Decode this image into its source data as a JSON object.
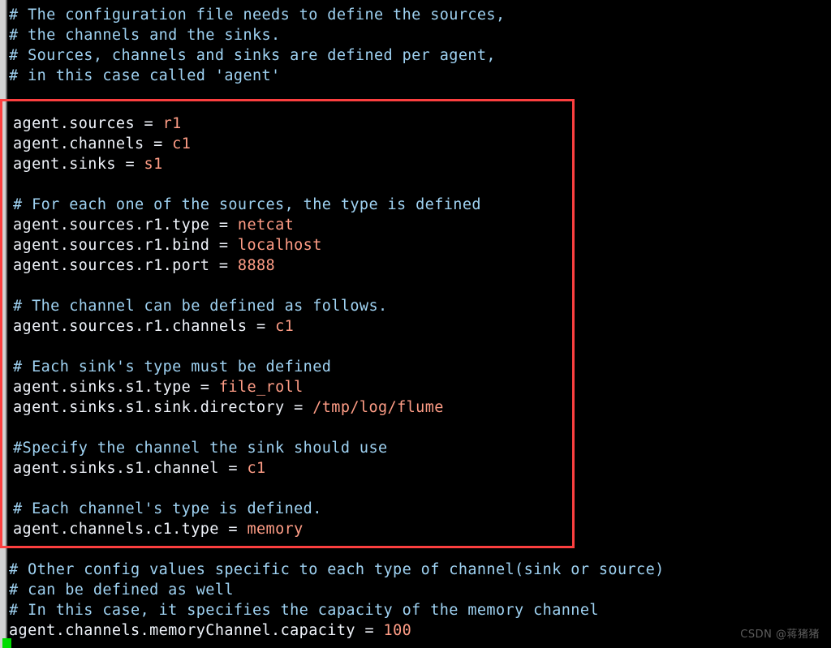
{
  "terminal": {
    "background_color": "#000000",
    "comment_color": "#9fd2f2",
    "key_color": "#f0f4fb",
    "value_color": "#ff9d86",
    "highlight_border_color": "#fc3f3f",
    "cursor_color": "#00dd00",
    "scrollbar_color": "#d2d2d2"
  },
  "header_comments": [
    "# The configuration file needs to define the sources,",
    "# the channels and the sinks.",
    "# Sources, channels and sinks are defined per agent,",
    "# in this case called 'agent'"
  ],
  "config_block": [
    {
      "type": "setting",
      "key": "agent.sources",
      "op": " = ",
      "value": "r1"
    },
    {
      "type": "setting",
      "key": "agent.channels",
      "op": " = ",
      "value": "c1"
    },
    {
      "type": "setting",
      "key": "agent.sinks",
      "op": " = ",
      "value": "s1"
    },
    {
      "type": "blank",
      "text": ""
    },
    {
      "type": "comment",
      "text": "# For each one of the sources, the type is defined"
    },
    {
      "type": "setting",
      "key": "agent.sources.r1.type",
      "op": " = ",
      "value": "netcat"
    },
    {
      "type": "setting",
      "key": "agent.sources.r1.bind",
      "op": " = ",
      "value": "localhost"
    },
    {
      "type": "setting",
      "key": "agent.sources.r1.port",
      "op": " = ",
      "value": "8888"
    },
    {
      "type": "blank",
      "text": ""
    },
    {
      "type": "comment",
      "text": "# The channel can be defined as follows."
    },
    {
      "type": "setting",
      "key": "agent.sources.r1.channels",
      "op": " = ",
      "value": "c1"
    },
    {
      "type": "blank",
      "text": ""
    },
    {
      "type": "comment",
      "text": "# Each sink's type must be defined"
    },
    {
      "type": "setting",
      "key": "agent.sinks.s1.type",
      "op": " = ",
      "value": "file_roll"
    },
    {
      "type": "setting",
      "key": "agent.sinks.s1.sink.directory",
      "op": " = ",
      "value": "/tmp/log/flume"
    },
    {
      "type": "blank",
      "text": ""
    },
    {
      "type": "comment",
      "text": "#Specify the channel the sink should use"
    },
    {
      "type": "setting",
      "key": "agent.sinks.s1.channel",
      "op": " = ",
      "value": "c1"
    },
    {
      "type": "blank",
      "text": ""
    },
    {
      "type": "comment",
      "text": "# Each channel's type is defined."
    },
    {
      "type": "setting",
      "key": "agent.channels.c1.type",
      "op": " = ",
      "value": "memory"
    }
  ],
  "footer_block": [
    {
      "type": "comment",
      "text": "# Other config values specific to each type of channel(sink or source)"
    },
    {
      "type": "comment",
      "text": "# can be defined as well"
    },
    {
      "type": "comment",
      "text": "# In this case, it specifies the capacity of the memory channel"
    },
    {
      "type": "setting",
      "key": "agent.channels.memoryChannel.capacity",
      "op": " = ",
      "value": "100"
    }
  ],
  "watermark": "CSDN @蒋猪猪"
}
